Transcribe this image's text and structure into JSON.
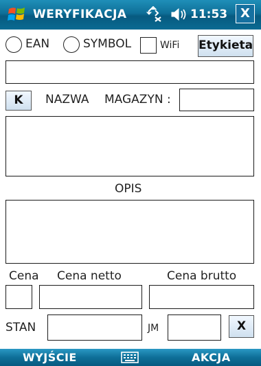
{
  "titlebar": {
    "title": "WERYFIKACJA",
    "time": "11:53",
    "close_label": "X"
  },
  "scan_mode": {
    "ean_label": "EAN",
    "symbol_label": "SYMBOL",
    "wifi_label": "WiFi",
    "etykieta_label": "Etykieta"
  },
  "row_nazwa": {
    "k_label": "K",
    "nazwa_label": "NAZWA",
    "magazyn_label": "MAGAZYN :"
  },
  "opis_label": "OPIS",
  "prices": {
    "cena_label": "Cena",
    "netto_label": "Cena netto",
    "brutto_label": "Cena brutto"
  },
  "stock": {
    "stan_label": "STAN",
    "jm_label": "JM",
    "clear_label": "X"
  },
  "softkeys": {
    "left": "WYJŚCIE",
    "right": "AKCJA"
  },
  "colors": {
    "bar_blue": "#0e6f98",
    "button_face": "#cfe0ef"
  }
}
